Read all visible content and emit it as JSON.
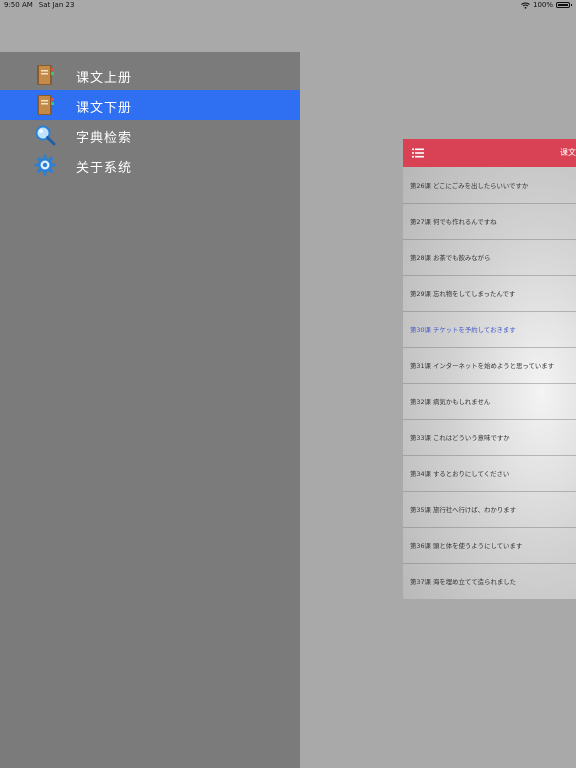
{
  "status": {
    "time": "9:50 AM",
    "date": "Sat Jan 23",
    "battery": "100%",
    "battery_level": 1.0
  },
  "menu": {
    "items": [
      {
        "label": "课文上册",
        "icon": "book-icon"
      },
      {
        "label": "课文下册",
        "icon": "book-icon",
        "selected": true
      },
      {
        "label": "字典检索",
        "icon": "magnifier-icon"
      },
      {
        "label": "关于系统",
        "icon": "gear-icon"
      }
    ]
  },
  "content": {
    "title": "课文",
    "header_color": "#d94255",
    "lessons": [
      "第26课 どこにごみを出したらいいですか",
      "第27课 何でも作れるんですね",
      "第28课 お茶でも飲みながら",
      "第29课 忘れ物をしてしまったんです",
      "第30课 チケットを予約しておきます",
      "第31课 インターネットを始めようと思っています",
      "第32课 病気かもしれません",
      "第33课 これはどういう意味ですか",
      "第34课 するとおりにしてください",
      "第35课 旅行社へ行けば、わかります",
      "第36课 頭と体を使うようにしています",
      "第37课 海を埋め立てて造られました"
    ],
    "active_index": 4
  },
  "colors": {
    "menu_background": "#7b7b7b",
    "selected_highlight": "#2f6ff1",
    "active_lesson_text": "#4156c8"
  }
}
